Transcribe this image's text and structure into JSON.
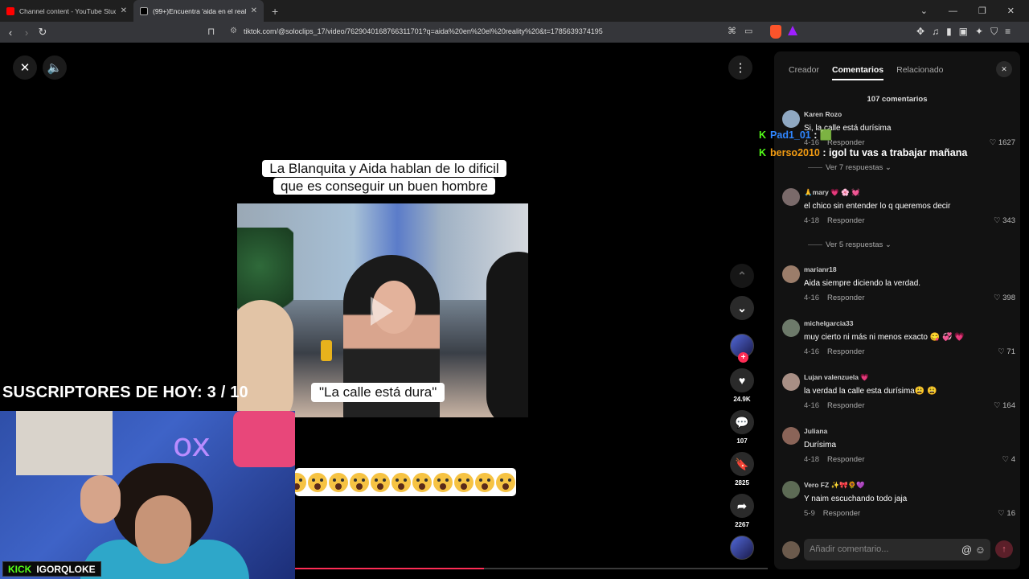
{
  "browser": {
    "tabs": [
      {
        "title": "Channel content - YouTube Studio",
        "favicon_color": "#ff0000"
      },
      {
        "title": "(99+)Encuentra 'aida en el reality'",
        "favicon_color": "#ffffff"
      }
    ],
    "new_tab": "+",
    "url": "tiktok.com/@soloclips_17/video/7629040168766311701?q=aida%20en%20el%20reality%20&t=1785639374195"
  },
  "video": {
    "caption_top": "La Blanquita y Aida hablan de lo dificil que es conseguir un buen hombre",
    "caption_mid": "\"La calle está dura\"",
    "emoji_count": 11,
    "progress_fraction": 0.4
  },
  "stream": {
    "subs_today": "SUSCRIPTORES DE HOY: 3 / 10",
    "kick_label": "KICK",
    "kick_user": "IGORQLOKE"
  },
  "chat_overlay": [
    {
      "user": "Pad1_01",
      "text": ": 🟩",
      "color": "#2f86ff"
    },
    {
      "user": "berso2010",
      "text": ": igol tu vas a trabajar mañana",
      "color": "#f39c12"
    }
  ],
  "actions": {
    "likes": "24.9K",
    "comments": "107",
    "saves": "2825",
    "shares": "2267"
  },
  "panel": {
    "tabs": [
      "Creador",
      "Comentarios",
      "Relacionado"
    ],
    "active_tab": "Comentarios",
    "count": "107 comentarios",
    "reply_label": "Responder",
    "comments": [
      {
        "user": "Karen Rozo",
        "text": "Si, la calle está durísima",
        "date": "4-16",
        "likes": "1627",
        "more": "Ver 7 respuestas"
      },
      {
        "user": "🙏mary 💗 🌸 💓",
        "text": "el chico sin entender lo q queremos decir",
        "date": "4-18",
        "likes": "343",
        "more": "Ver 5 respuestas"
      },
      {
        "user": "marianr18",
        "text": "Aida siempre diciendo la verdad.",
        "date": "4-16",
        "likes": "398"
      },
      {
        "user": "michelgarcia33",
        "text": "muy cierto ni más ni menos exacto 😋 💞 💗",
        "date": "4-16",
        "likes": "71"
      },
      {
        "user": "Lujan valenzuela 💗",
        "text": "la verdad la calle esta durísima😩 😩",
        "date": "4-16",
        "likes": "164"
      },
      {
        "user": "Juliana",
        "text": "Durísima",
        "date": "4-18",
        "likes": "4"
      },
      {
        "user": "Vero FZ ✨🎀🌻💜",
        "text": "Y naim escuchando todo jaja",
        "date": "5-9",
        "likes": "16"
      }
    ],
    "composer_placeholder": "Añadir comentario..."
  }
}
